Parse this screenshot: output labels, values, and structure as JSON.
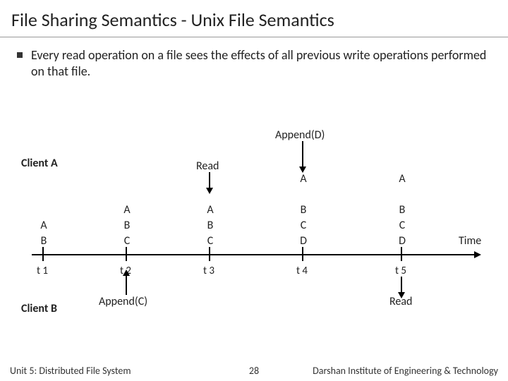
{
  "title": "File Sharing Semantics - Unix File Semantics",
  "bullet": "Every read operation on a file sees the effects of all previous write operations performed on that file.",
  "upper": {
    "clientA": "Client A",
    "appendD": "Append(D)",
    "read": "Read",
    "timeLabel": "Time"
  },
  "lower": {
    "clientB": "Client B",
    "appendC": "Append(C)",
    "read": "Read"
  },
  "ticks": [
    "t 1",
    "t 2",
    "t 3",
    "t 4",
    "t 5"
  ],
  "cols": {
    "c1": [
      "A",
      "B"
    ],
    "c2": [
      "A",
      "B",
      "C"
    ],
    "c3": [
      "A",
      "B",
      "C"
    ],
    "c4": [
      "A",
      "B",
      "C",
      "D"
    ],
    "c5": [
      "A",
      "B",
      "C",
      "D"
    ]
  },
  "footer": {
    "left": "Unit 5: Distributed File System",
    "page": "28",
    "right": "Darshan Institute of Engineering & Technology"
  }
}
